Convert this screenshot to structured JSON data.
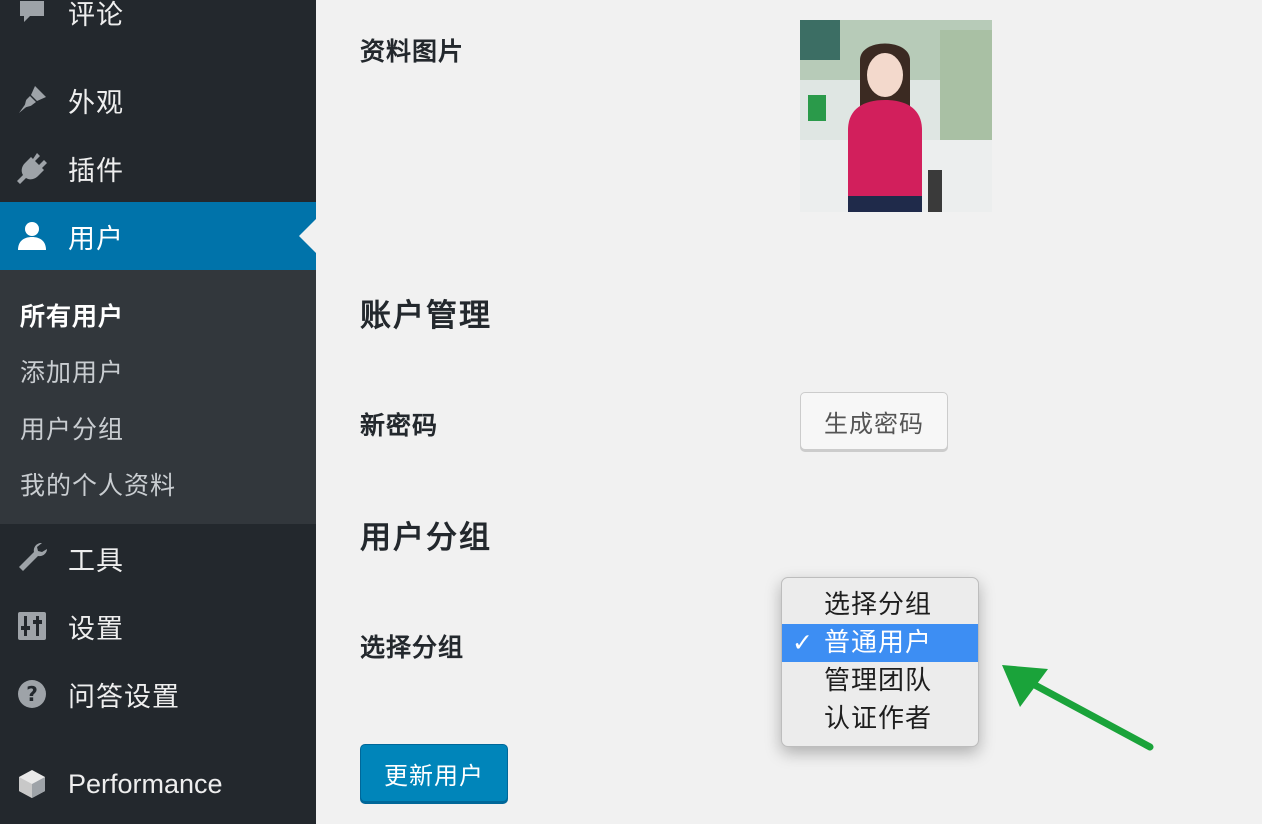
{
  "sidebar": {
    "items": [
      {
        "label": "评论",
        "icon": "comment-icon"
      },
      {
        "label": "外观",
        "icon": "paintbrush-icon"
      },
      {
        "label": "插件",
        "icon": "plugin-icon"
      },
      {
        "label": "用户",
        "icon": "user-icon"
      },
      {
        "label": "工具",
        "icon": "wrench-icon"
      },
      {
        "label": "设置",
        "icon": "settings-sliders-icon"
      },
      {
        "label": "问答设置",
        "icon": "help-icon"
      },
      {
        "label": "Performance",
        "icon": "performance-cube-icon"
      }
    ],
    "submenu": [
      "所有用户",
      "添加用户",
      "用户分组",
      "我的个人资料"
    ],
    "active_color": "#0073aa",
    "background": "#23282d"
  },
  "main": {
    "profile_picture_label": "资料图片",
    "account_section_title": "账户管理",
    "new_password_label": "新密码",
    "generate_password_button": "生成密码",
    "group_section_title": "用户分组",
    "select_group_label": "选择分组",
    "group_options": [
      "选择分组",
      "普通用户",
      "管理团队",
      "认证作者"
    ],
    "selected_option_index": 1,
    "selected_check": "✓",
    "update_button": "更新用户",
    "primary_color": "#0085ba"
  },
  "annotation": {
    "arrow_color": "#1aa33a",
    "icon": "green-arrow-annotation"
  }
}
